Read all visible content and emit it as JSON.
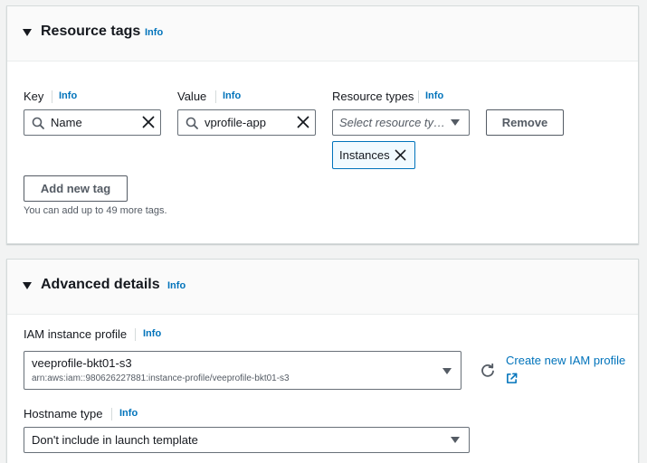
{
  "resource_tags": {
    "title": "Resource tags",
    "info": "Info",
    "key_label": "Key",
    "value_label": "Value",
    "resource_types_label": "Resource types",
    "key_value": "Name",
    "value_value": "vprofile-app",
    "resource_types_placeholder": "Select resource ty…",
    "remove_label": "Remove",
    "token_label": "Instances",
    "add_tag_label": "Add new tag",
    "hint": "You can add up to 49 more tags."
  },
  "advanced_details": {
    "title": "Advanced details",
    "info": "Info",
    "iam_label": "IAM instance profile",
    "iam_value": "veeprofile-bkt01-s3",
    "iam_arn": "arn:aws:iam::980626227881:instance-profile/veeprofile-bkt01-s3",
    "create_iam_label": "Create new IAM profile",
    "hostname_label": "Hostname type",
    "hostname_value": "Don't include in launch template"
  },
  "icons": {
    "caret": "caret-down-icon",
    "search": "search-icon",
    "clear": "close-icon",
    "dropdown": "chevron-down-icon",
    "refresh": "refresh-icon",
    "external": "external-link-icon"
  },
  "colors": {
    "link": "#0073bb",
    "text": "#16191f",
    "border": "#687078",
    "token_bg": "#f1faff"
  }
}
